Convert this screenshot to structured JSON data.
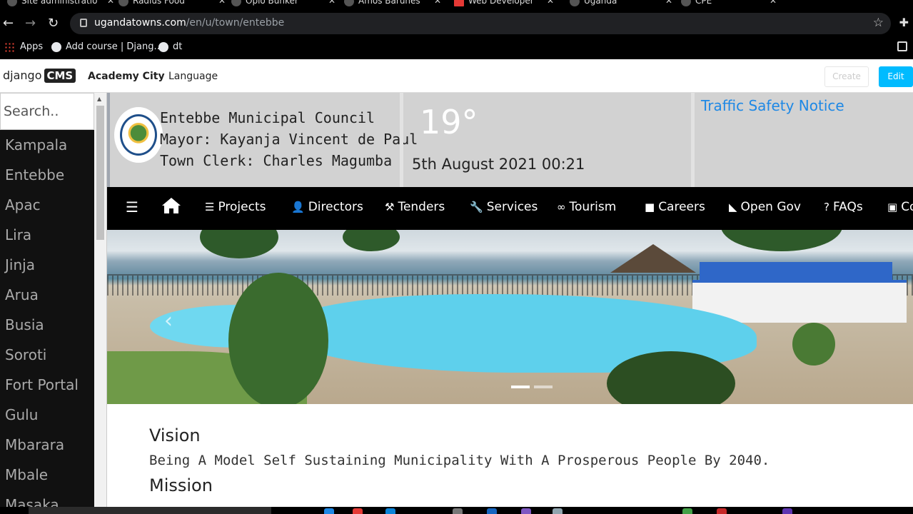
{
  "browser": {
    "tabs": [
      {
        "title": "Site administratio"
      },
      {
        "title": "Radius Food"
      },
      {
        "title": "Opio Bunker"
      },
      {
        "title": "Amos Barunes"
      },
      {
        "title": "Web Developer"
      },
      {
        "title": "Uganda"
      },
      {
        "title": "CPE"
      }
    ],
    "url_host": "ugandatowns.com",
    "url_path": "/en/u/town/entebbe",
    "bookmarks": [
      {
        "label": "Apps"
      },
      {
        "label": "Add course | Djang..."
      },
      {
        "label": "dt"
      }
    ]
  },
  "cms": {
    "logo_text": "django",
    "logo_badge": "CMS",
    "site_name": "Academy City",
    "language_label": "Language",
    "create_label": "Create",
    "edit_label": "Edit"
  },
  "sidebar": {
    "search_placeholder": "Search..",
    "towns": [
      "Kampala",
      "Entebbe",
      "Apac",
      "Lira",
      "Jinja",
      "Arua",
      "Busia",
      "Soroti",
      "Fort Portal",
      "Gulu",
      "Mbarara",
      "Mbale",
      "Masaka"
    ]
  },
  "header": {
    "council_name": "Entebbe Municipal Council",
    "mayor": "Mayor: Kayanja Vincent de Paul",
    "clerk": "Town Clerk: Charles Magumba",
    "temperature": "19°",
    "datetime": "5th August 2021 00:21",
    "notice": "Traffic Safety Notice"
  },
  "nav": {
    "menu_icon": "☰",
    "items": [
      {
        "label": "Projects",
        "icon": "list-icon"
      },
      {
        "label": "Directors",
        "icon": "users-icon"
      },
      {
        "label": "Tenders",
        "icon": "gavel-icon"
      },
      {
        "label": "Services",
        "icon": "wrench-icon"
      },
      {
        "label": "Tourism",
        "icon": "binoculars-icon"
      },
      {
        "label": "Careers",
        "icon": "briefcase-icon"
      },
      {
        "label": "Open Gov",
        "icon": "rss-icon"
      },
      {
        "label": "FAQs",
        "icon": "question-icon"
      },
      {
        "label": "Co",
        "icon": "contact-icon"
      }
    ]
  },
  "content": {
    "vision_heading": "Vision",
    "vision_text": "Being A Model Self Sustaining Municipality With A Prosperous People By 2040.",
    "mission_heading": "Mission"
  }
}
